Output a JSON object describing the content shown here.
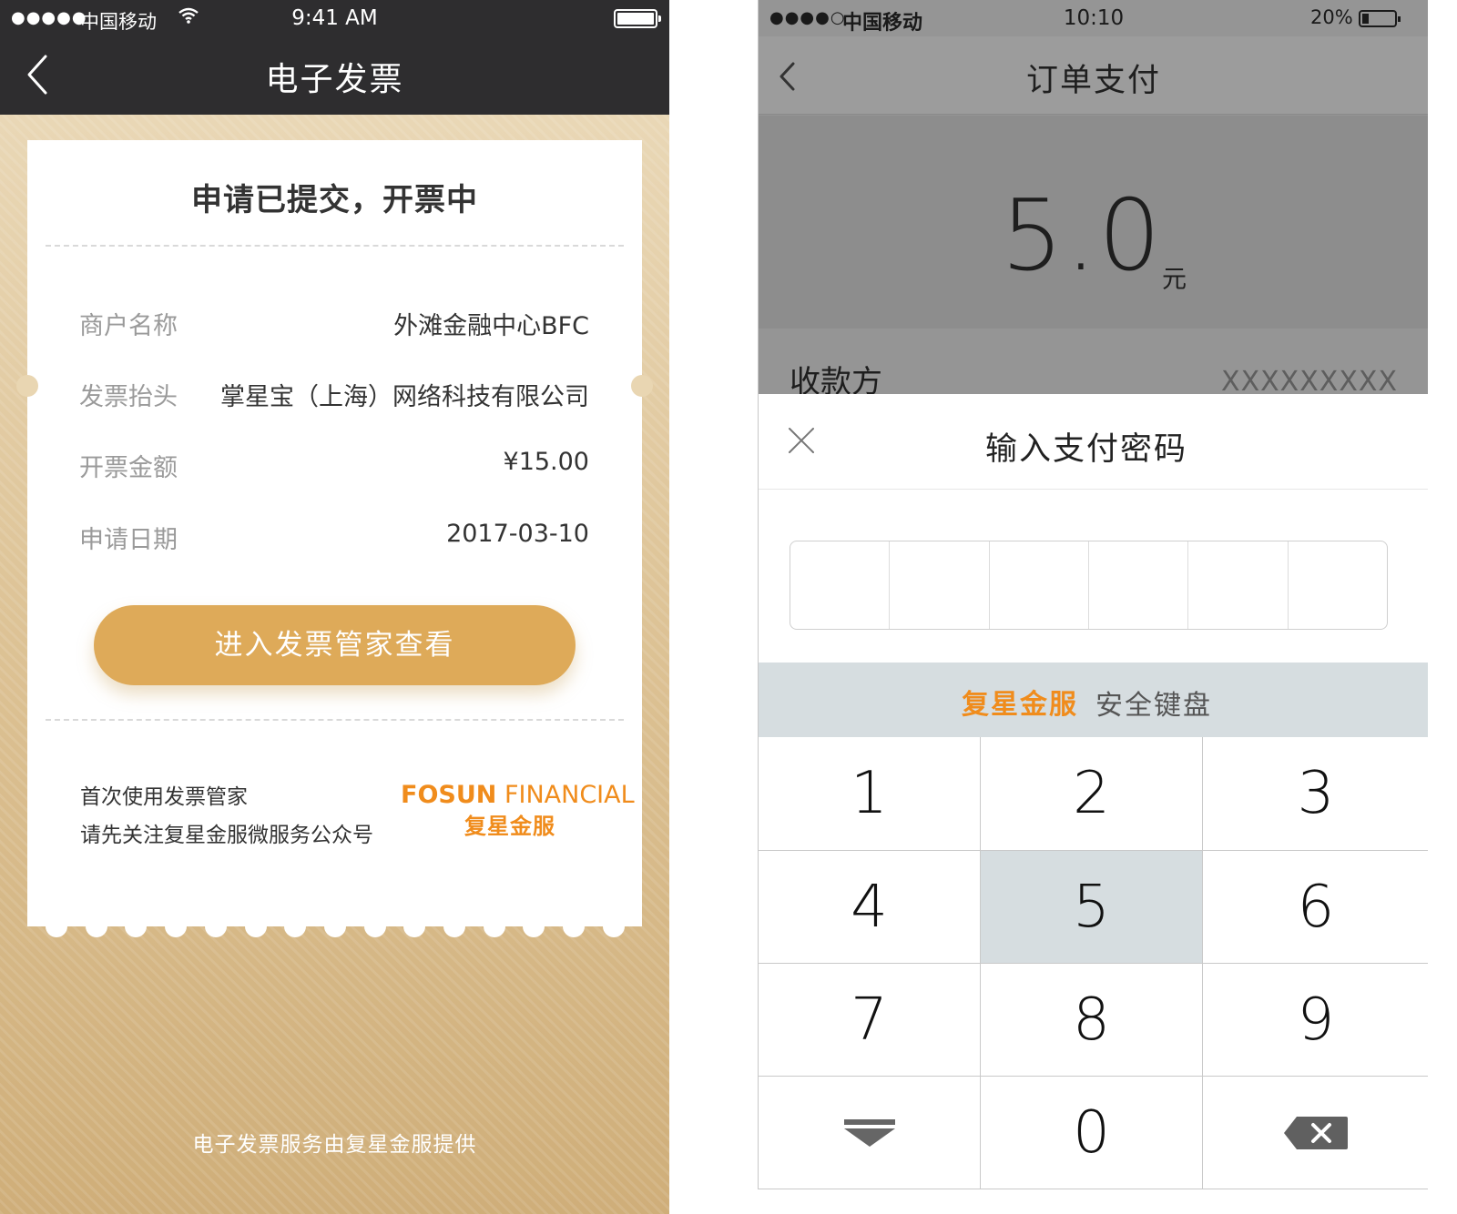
{
  "left": {
    "status": {
      "signal": "●●●●●",
      "carrier": "中国移动",
      "time": "9:41 AM"
    },
    "nav": {
      "title": "电子发票"
    },
    "ticket": {
      "title": "申请已提交，开票中",
      "rows": [
        {
          "label": "商户名称",
          "value": "外滩金融中心BFC"
        },
        {
          "label": "发票抬头",
          "value": "掌星宝（上海）网络科技有限公司"
        },
        {
          "label": "开票金额",
          "value": "¥15.00"
        },
        {
          "label": "申请日期",
          "value": "2017-03-10"
        }
      ],
      "button": "进入发票管家查看",
      "footer_line1": "首次使用发票管家",
      "footer_line2": "请先关注复星金服微服务公众号",
      "brand_en_bold": "FOSUN",
      "brand_en_rest": "FINANCIAL",
      "brand_cn": "复星金服"
    },
    "footer": "电子发票服务由复星金服提供"
  },
  "right": {
    "status": {
      "signal": "●●●●○",
      "carrier": "中国移动",
      "time": "10:10",
      "battery": "20%"
    },
    "nav": {
      "title": "订单支付"
    },
    "amount": "5.0",
    "unit": "元",
    "payee_label": "收款方",
    "payee_value": "XXXXXXXXX",
    "sheet_title": "输入支付密码",
    "keyboard_brand": "复星金服",
    "keyboard_label": "安全键盘",
    "keys": [
      "1",
      "2",
      "3",
      "4",
      "5",
      "6",
      "7",
      "8",
      "9",
      "0"
    ]
  },
  "colors": {
    "accent": "#deaa59",
    "brand_orange": "#f08c1c",
    "navbar_dark": "#2e2d2f",
    "overlay_gray": "#959595",
    "keypad_highlight": "#d6dde0"
  },
  "icons": [
    "back-chevron-icon",
    "wifi-icon",
    "battery-icon",
    "close-icon",
    "keyboard-dismiss-icon",
    "backspace-icon"
  ]
}
